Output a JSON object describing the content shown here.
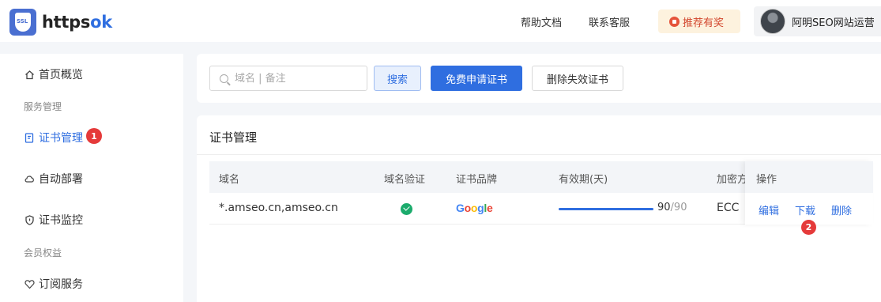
{
  "header": {
    "brand_left": "https",
    "brand_accent": "ok",
    "logo_text": "SSL",
    "nav": [
      "帮助文档",
      "联系客服"
    ],
    "promo": "推荐有奖",
    "user_name": "阿明SEO网站运营"
  },
  "sidebar": {
    "home": "首页概览",
    "group_service": "服务管理",
    "cert_manage": "证书管理",
    "cert_manage_badge": "1",
    "auto_deploy": "自动部署",
    "cert_monitor": "证书监控",
    "group_member": "会员权益",
    "subscribe": "订阅服务"
  },
  "toolbar": {
    "search_placeholder": "域名 | 备注",
    "search_label": "搜索",
    "apply_label": "免费申请证书",
    "delete_invalid_label": "删除失效证书"
  },
  "table": {
    "title": "证书管理",
    "columns": [
      "域名",
      "域名验证",
      "证书品牌",
      "有效期(天)",
      "加密方",
      "操作"
    ],
    "rows": [
      {
        "domain": "*.amseo.cn,amseo.cn",
        "verified": true,
        "brand": "Google",
        "validity_current": "90",
        "validity_total": "/90",
        "validity_fraction": 1.0,
        "encryption": "ECC",
        "ops": [
          "编辑",
          "下载",
          "删除"
        ]
      }
    ],
    "download_badge": "2"
  },
  "colors": {
    "primary": "#2f6ee0",
    "badge": "#e53a3a",
    "success": "#1bab6c",
    "google": [
      "#4285f4",
      "#ea4335",
      "#fbbc05",
      "#4285f4",
      "#34a853",
      "#ea4335"
    ]
  }
}
